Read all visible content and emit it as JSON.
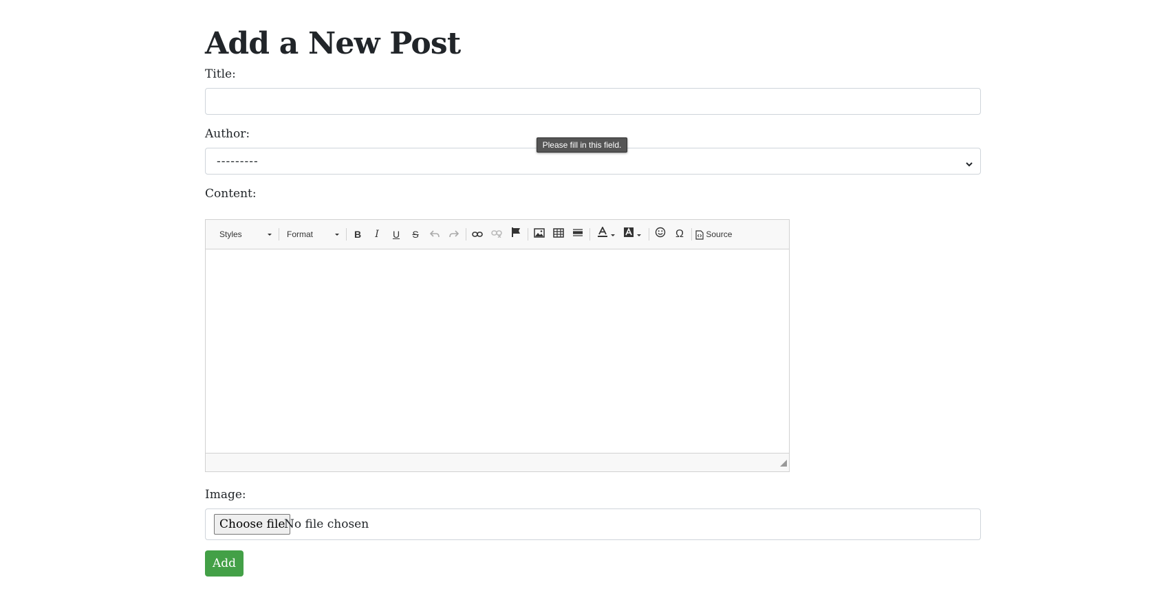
{
  "page": {
    "title": "Add a New Post"
  },
  "form": {
    "title_label": "Title:",
    "title_value": "",
    "author_label": "Author:",
    "author_selected": "---------",
    "content_label": "Content:",
    "image_label": "Image:",
    "choose_file_label": "Choose file",
    "no_file_text": "No file chosen",
    "submit_label": "Add"
  },
  "tooltip": {
    "text": "Please fill in this field."
  },
  "editor": {
    "styles_label": "Styles",
    "format_label": "Format",
    "bold": "B",
    "italic": "I",
    "underline": "U",
    "strike": "S",
    "special_char": "Ω",
    "source_label": "Source",
    "content": ""
  },
  "colors": {
    "accent_green": "#43a047",
    "toolbar_bg": "#f8f8f8",
    "border": "#ced4da",
    "tooltip_bg": "#555555"
  }
}
